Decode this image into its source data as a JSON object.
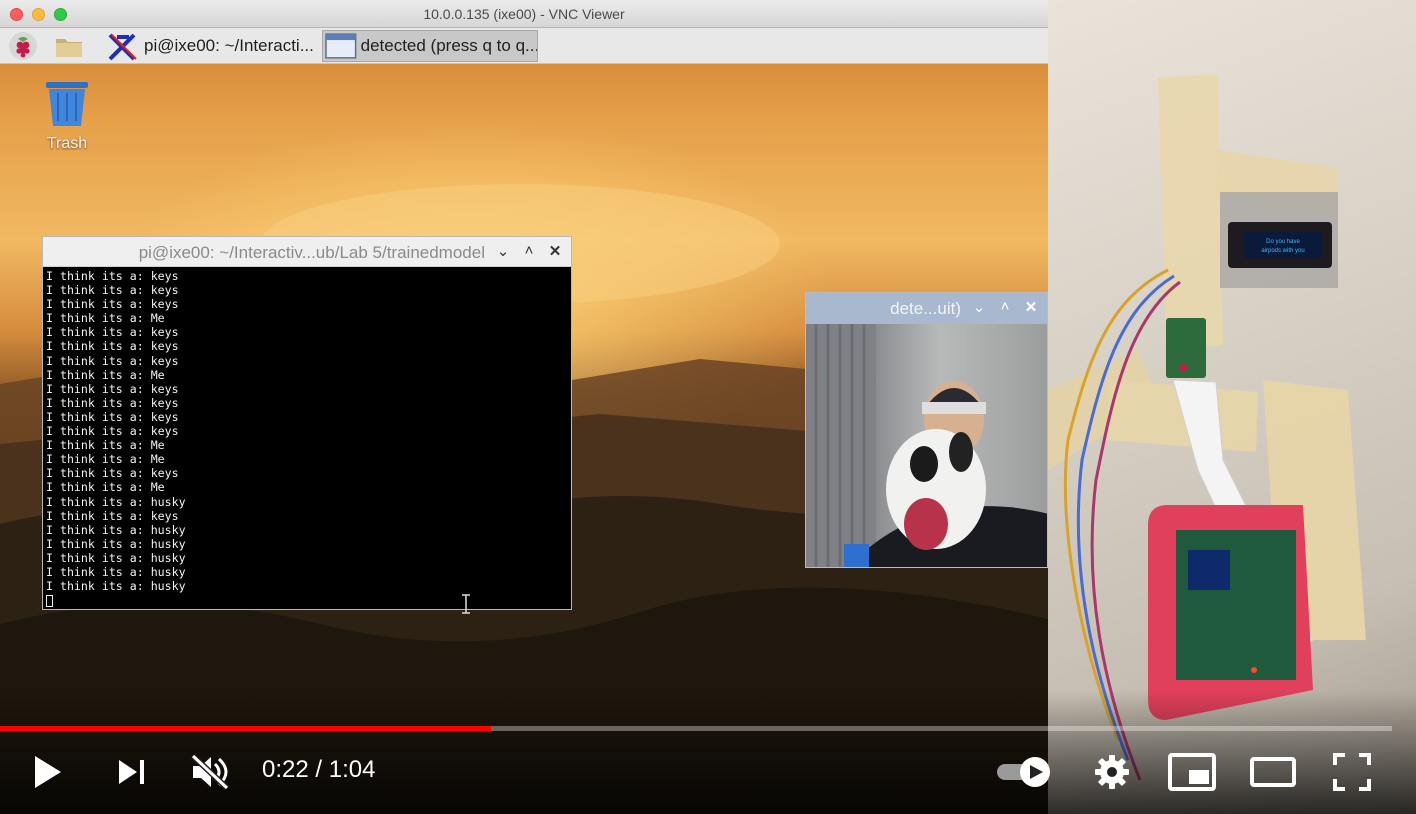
{
  "vnc": {
    "title": "10.0.0.135 (ixe00) - VNC Viewer"
  },
  "taskbar": {
    "terminal_task": "pi@ixe00: ~/Interacti...",
    "detected_task": "detected (press q to q..."
  },
  "desktop": {
    "trash_label": "Trash"
  },
  "terminal": {
    "title": "pi@ixe00: ~/Interactiv...ub/Lab 5/trainedmodel",
    "lines": [
      "I think its a: keys",
      "I think its a: keys",
      "I think its a: keys",
      "I think its a: Me",
      "I think its a: keys",
      "I think its a: keys",
      "I think its a: keys",
      "I think its a: Me",
      "I think its a: keys",
      "I think its a: keys",
      "I think its a: keys",
      "I think its a: keys",
      "I think its a: Me",
      "I think its a: Me",
      "I think its a: keys",
      "I think its a: Me",
      "I think its a: husky",
      "I think its a: keys",
      "I think its a: husky",
      "I think its a: husky",
      "I think its a: husky",
      "I think its a: husky",
      "I think its a: husky"
    ]
  },
  "camera_window": {
    "title": "dete...uit)"
  },
  "oled": {
    "line1": "Do you have",
    "line2": "airpods with you"
  },
  "player": {
    "current_time": "0:22",
    "separator": " / ",
    "duration": "1:04",
    "progress_fraction": 0.353,
    "autoplay": "on",
    "accent_color": "#ff0000"
  }
}
